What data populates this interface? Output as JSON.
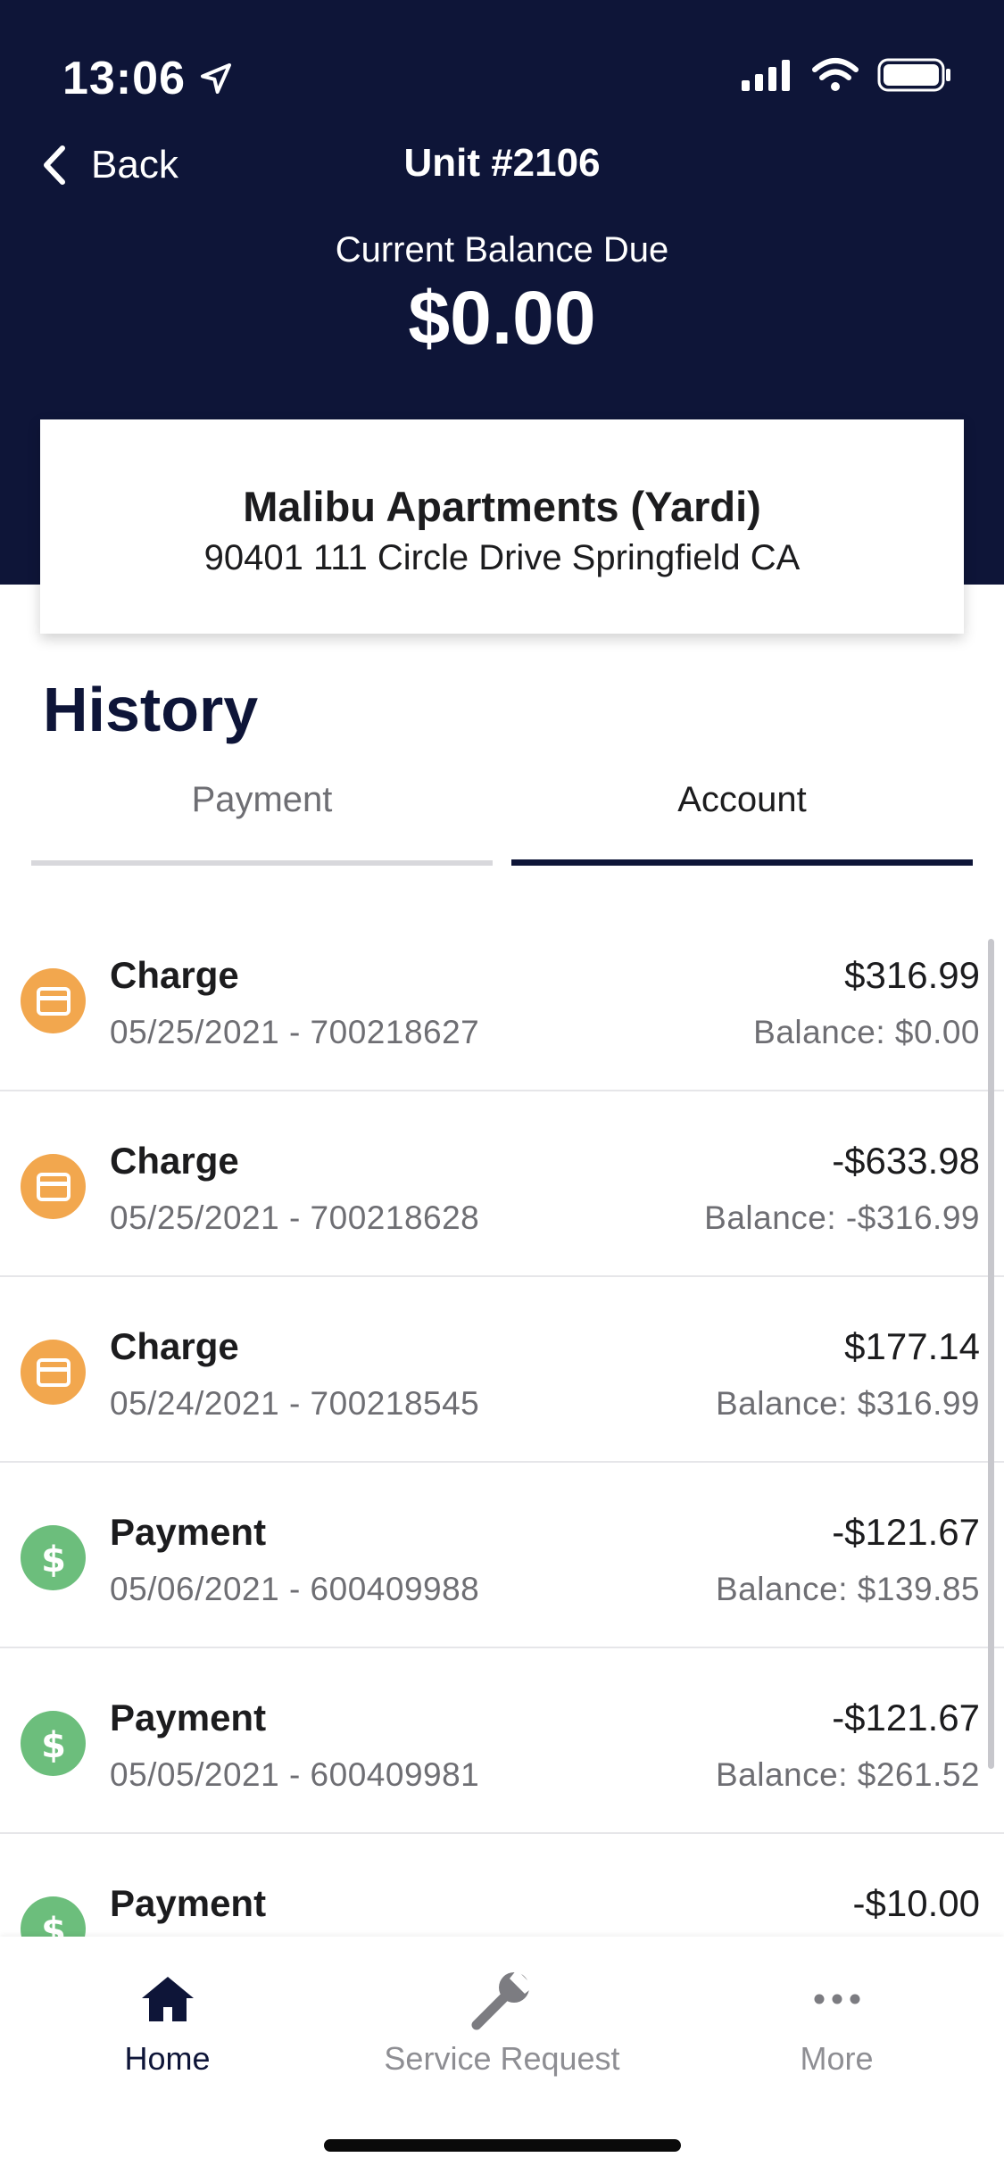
{
  "status_bar": {
    "time": "13:06"
  },
  "nav": {
    "back_label": "Back",
    "title": "Unit #2106"
  },
  "balance": {
    "label": "Current Balance Due",
    "amount": "$0.00"
  },
  "property": {
    "name": "Malibu Apartments (Yardi)",
    "address": "90401 111 Circle Drive Springfield CA"
  },
  "history": {
    "title": "History",
    "tabs": [
      {
        "label": "Payment",
        "selected": false
      },
      {
        "label": "Account",
        "selected": true
      }
    ],
    "items": [
      {
        "type": "Charge",
        "meta": "05/25/2021 - 700218627",
        "amount": "$316.99",
        "balance": "Balance: $0.00",
        "icon": "credit-card-icon"
      },
      {
        "type": "Charge",
        "meta": "05/25/2021 - 700218628",
        "amount": "-$633.98",
        "balance": "Balance: -$316.99",
        "icon": "credit-card-icon"
      },
      {
        "type": "Charge",
        "meta": "05/24/2021 - 700218545",
        "amount": "$177.14",
        "balance": "Balance: $316.99",
        "icon": "credit-card-icon"
      },
      {
        "type": "Payment",
        "meta": "05/06/2021 - 600409988",
        "amount": "-$121.67",
        "balance": "Balance: $139.85",
        "icon": "dollar-icon"
      },
      {
        "type": "Payment",
        "meta": "05/05/2021 - 600409981",
        "amount": "-$121.67",
        "balance": "Balance: $261.52",
        "icon": "dollar-icon"
      },
      {
        "type": "Payment",
        "meta": "",
        "amount": "-$10.00",
        "balance": "",
        "icon": "dollar-icon"
      }
    ]
  },
  "tab_bar": {
    "items": [
      {
        "label": "Home",
        "icon": "home-icon",
        "active": true
      },
      {
        "label": "Service Request",
        "icon": "wrench-icon",
        "active": false
      },
      {
        "label": "More",
        "icon": "more-dots-icon",
        "active": false
      }
    ]
  },
  "colors": {
    "navy": "#0e1538",
    "charge": "#f2a74e",
    "payment": "#6cbe7c",
    "muted": "#6e6e73"
  }
}
